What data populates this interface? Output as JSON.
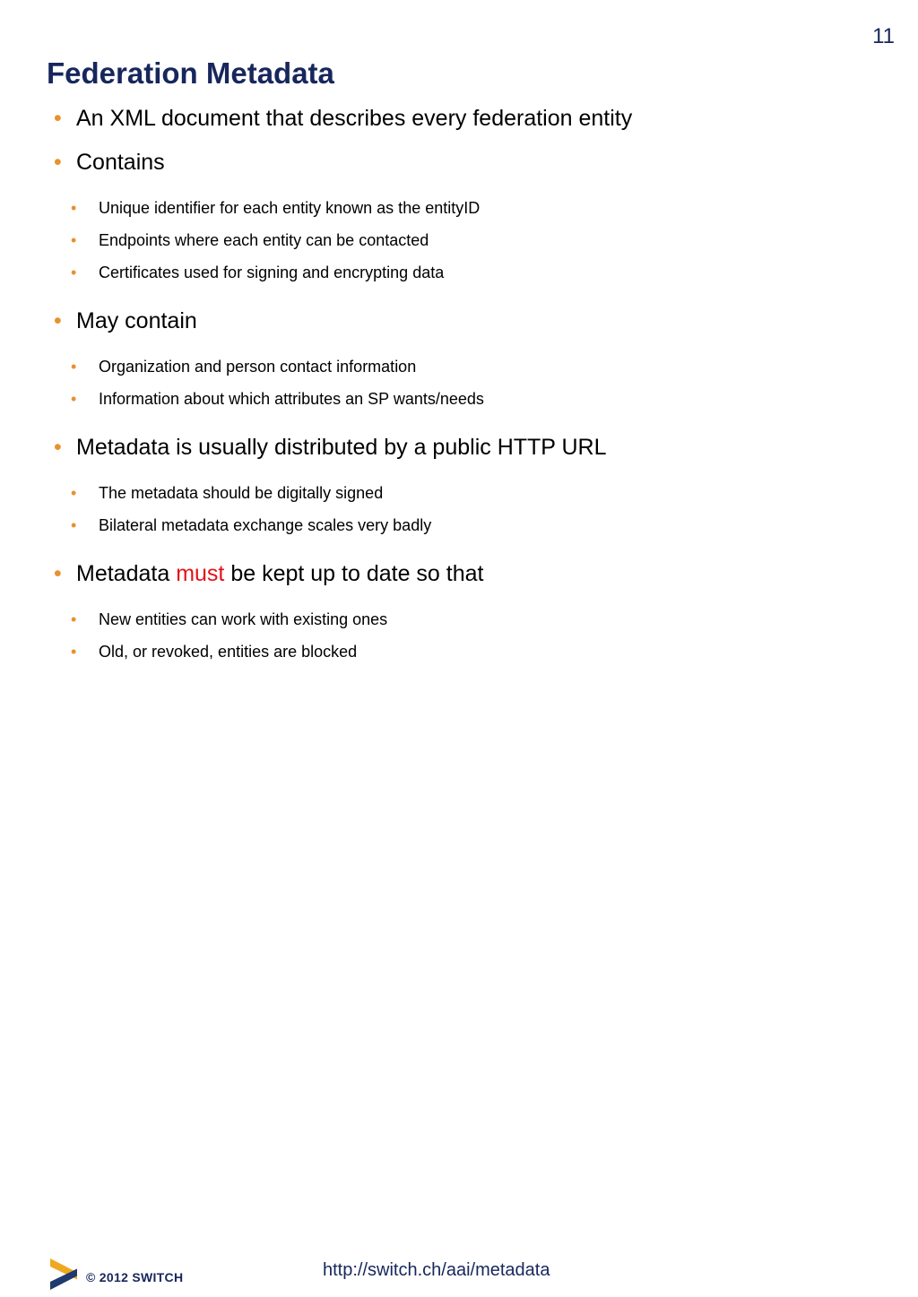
{
  "slide": {
    "title": "Federation Metadata",
    "page_number": "11",
    "background_color": "#ffffff",
    "title_color": "#17275c",
    "bullet_color": "#e8912d",
    "emphasis_color": "#e3121a",
    "body_text_color": "#000000"
  },
  "content": {
    "bullets": [
      {
        "level": 1,
        "text": "An XML document that describes every federation entity"
      },
      {
        "level": 1,
        "text": "Contains"
      },
      {
        "level": 2,
        "text": "Unique identifier for each entity known as the entityID"
      },
      {
        "level": 2,
        "text": "Endpoints where each entity can be contacted"
      },
      {
        "level": 2,
        "text": "Certificates used for signing and encrypting data"
      },
      {
        "level": 1,
        "text": "May contain"
      },
      {
        "level": 2,
        "text": "Organization and person contact information"
      },
      {
        "level": 2,
        "text": "Information about which attributes an SP wants/needs"
      },
      {
        "level": 1,
        "text": "Metadata is usually distributed by a public HTTP URL"
      },
      {
        "level": 2,
        "text": "The metadata should be digitally signed"
      },
      {
        "level": 2,
        "text": "Bilateral metadata exchange scales very badly"
      },
      {
        "level": 1,
        "text_before": "Metadata ",
        "emphasis": "must",
        "text_after": " be kept up to date so that"
      },
      {
        "level": 2,
        "text": "New entities can work with existing ones"
      },
      {
        "level": 2,
        "text": "Old, or revoked, entities are blocked"
      }
    ],
    "bullet_glyph": "•"
  },
  "footer": {
    "copyright": "© 2012 SWITCH",
    "url": "http://switch.ch/aai/metadata",
    "logo_name": "switch-logo",
    "logo_colors": {
      "top_chevron": "#f0a81e",
      "bottom_chevron": "#1f3a6e"
    }
  }
}
